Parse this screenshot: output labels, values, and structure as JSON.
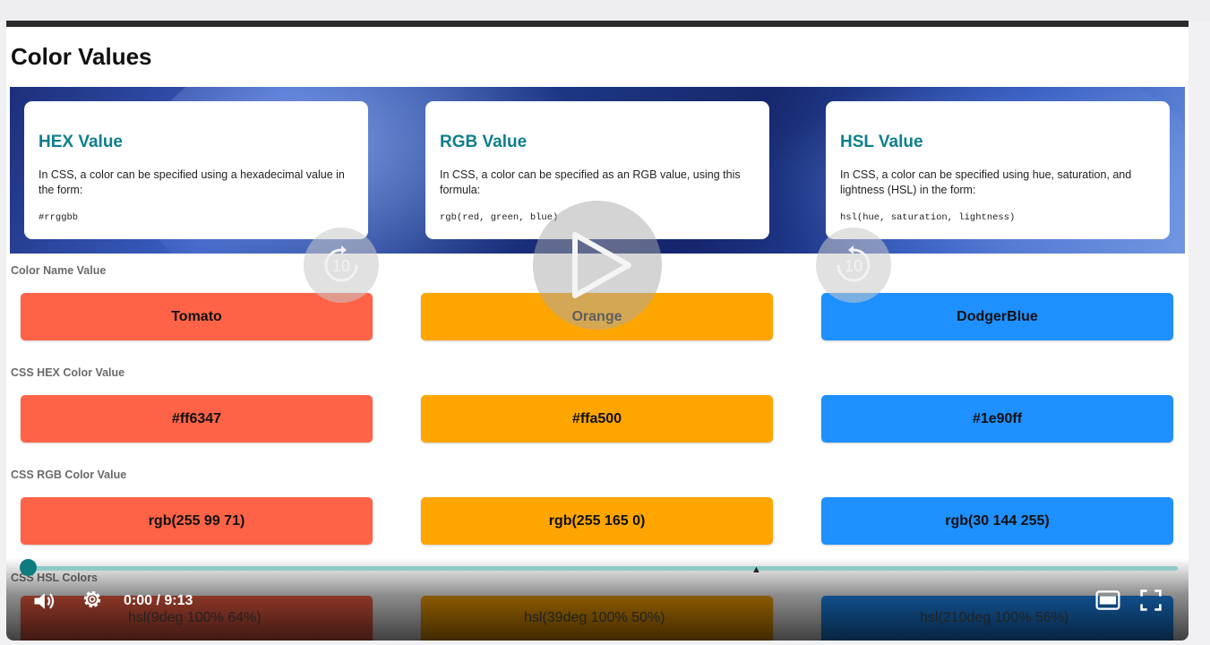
{
  "page": {
    "title": "Color Values"
  },
  "cards": [
    {
      "title": "HEX Value",
      "text": "In CSS, a color can be specified using a hexadecimal value in the form:",
      "code": "#rrggbb"
    },
    {
      "title": "RGB Value",
      "text": "In CSS, a color can be specified as an RGB value, using this formula:",
      "code": "rgb(red, green, blue)"
    },
    {
      "title": "HSL Value",
      "text": "In CSS, a color can be specified using hue, saturation, and lightness (HSL) in the form:",
      "code": "hsl(hue, saturation, lightness)"
    }
  ],
  "sections": {
    "names": {
      "label": "Color Name Value",
      "values": [
        "Tomato",
        "Orange",
        "DodgerBlue"
      ]
    },
    "hex": {
      "label": "CSS HEX Color Value",
      "values": [
        "#ff6347",
        "#ffa500",
        "#1e90ff"
      ]
    },
    "rgb": {
      "label": "CSS RGB Color Value",
      "values": [
        "rgb(255 99 71)",
        "rgb(255 165 0)",
        "rgb(30 144 255)"
      ]
    },
    "hsl": {
      "label": "CSS HSL Colors",
      "values": [
        "hsl(9deg 100% 64%)",
        "hsl(39deg 100% 50%)",
        "hsl(210deg 100% 56%)"
      ]
    }
  },
  "colors": {
    "tomato": "#ff6347",
    "orange": "#ffa500",
    "dodgerblue": "#1e90ff",
    "accent": "#0d7f8c"
  },
  "player": {
    "time": "0:00 / 9:13",
    "skip_back_label": "10",
    "skip_forward_label": "10",
    "progress": 0.0,
    "icons": [
      "volume-icon",
      "settings-gear-icon",
      "closed-captions-icon",
      "fullscreen-icon",
      "play-icon",
      "replay-10-icon",
      "forward-10-icon"
    ]
  }
}
